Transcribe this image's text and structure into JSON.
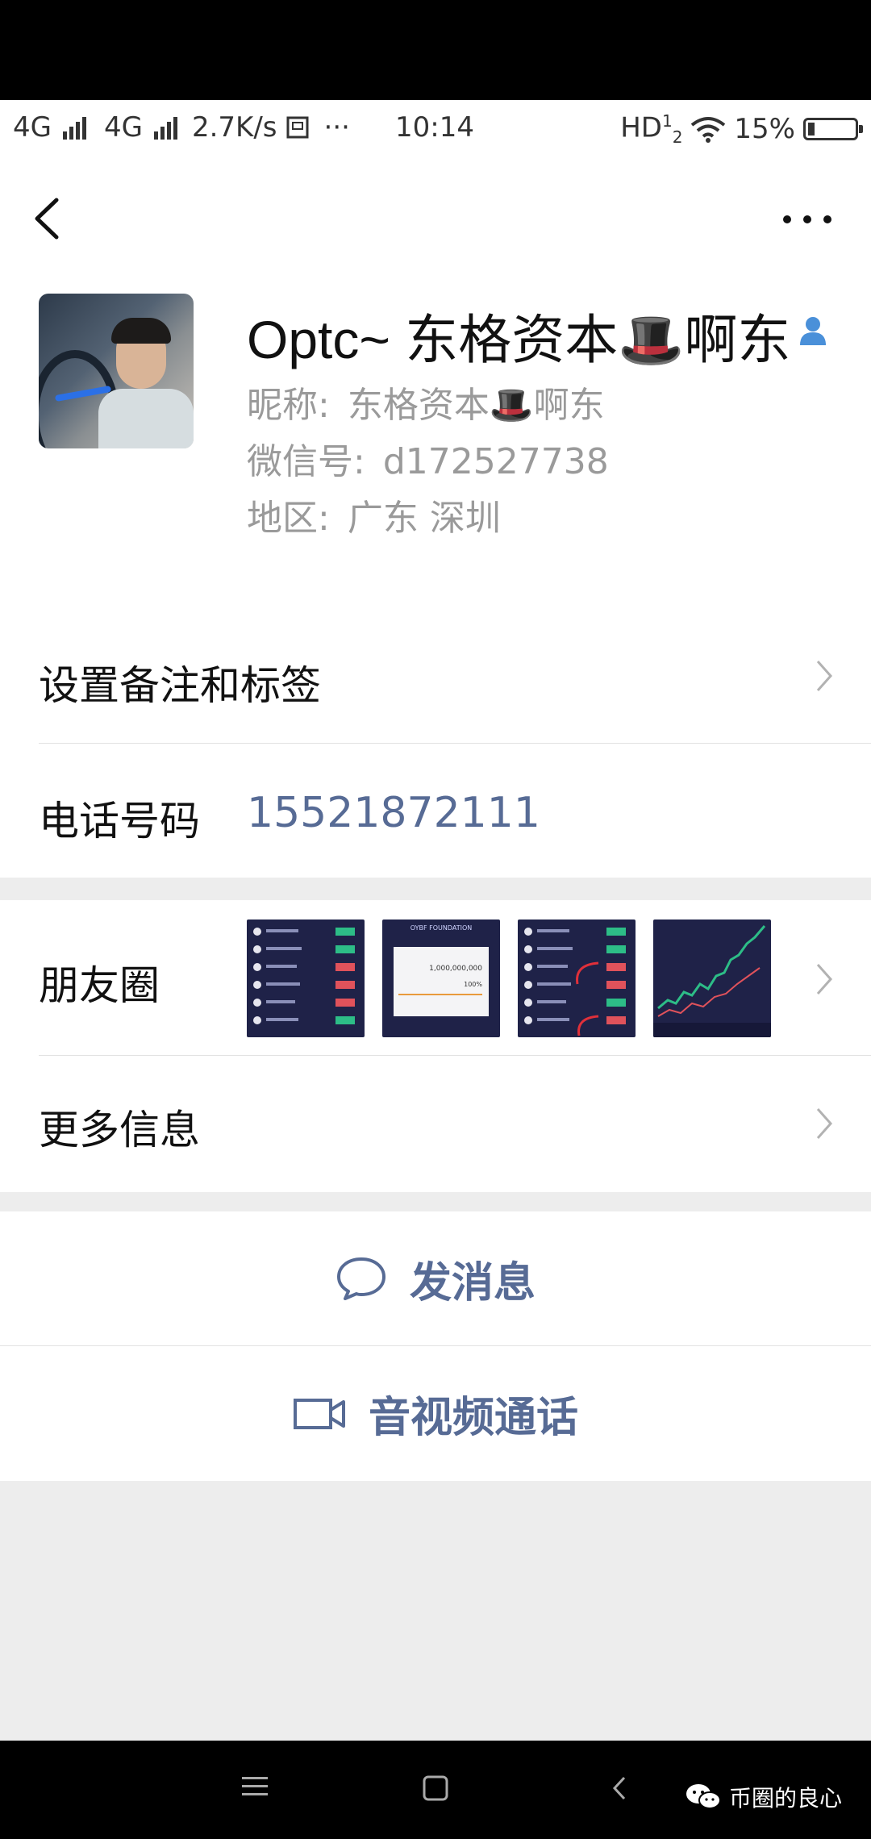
{
  "status_bar": {
    "network1": "4G",
    "network2": "4G",
    "speed": "2.7K/s",
    "more": "···",
    "time": "10:14",
    "hd": "HD",
    "hd_sub": "2",
    "hd_sup": "1",
    "battery": "15%"
  },
  "profile": {
    "name": "Optc~ 东格资本🎩啊东",
    "nickname_label": "昵称:",
    "nickname": "东格资本🎩啊东",
    "wechat_label": "微信号:",
    "wechat_id": "d172527738",
    "region_label": "地区:",
    "region": "广东  深圳"
  },
  "rows": {
    "remark_label": "设置备注和标签",
    "phone_label": "电话号码",
    "phone_value": "15521872111",
    "moments_label": "朋友圈",
    "more_info_label": "更多信息"
  },
  "moments_thumbs": [
    {
      "icon": "exchange-list-thumbnail"
    },
    {
      "icon": "foundation-thumbnail",
      "title": "OYBF FOUNDATION",
      "value": "1,000,000,000",
      "percent": "100%"
    },
    {
      "icon": "exchange-list-marked-thumbnail"
    },
    {
      "icon": "candlestick-chart-thumbnail"
    }
  ],
  "actions": {
    "message_label": "发消息",
    "call_label": "音视频通话"
  },
  "watermark": {
    "text": "币圈的良心"
  },
  "colors": {
    "link_blue": "#576b95",
    "accent_green": "#2dbd87",
    "accent_red": "#e0525b",
    "background": "#ededed"
  }
}
